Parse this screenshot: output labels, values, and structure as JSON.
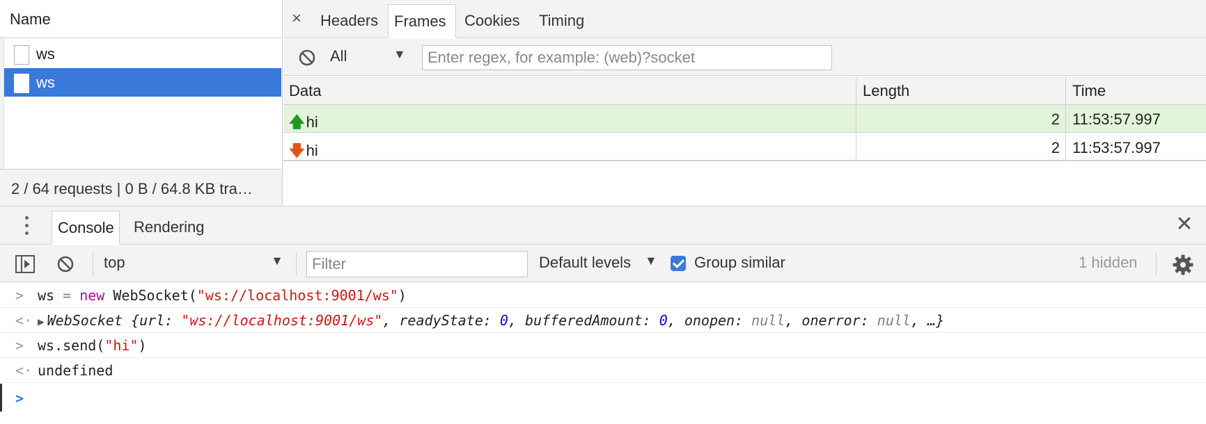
{
  "network": {
    "name_header": "Name",
    "requests": [
      {
        "label": "ws"
      },
      {
        "label": "ws"
      }
    ],
    "footer": "2 / 64 requests | 0 B / 64.8 KB tra…",
    "detail_tabs": {
      "close": "×",
      "headers": "Headers",
      "frames": "Frames",
      "cookies": "Cookies",
      "timing": "Timing"
    },
    "frames_toolbar": {
      "type_filter": "All",
      "search_placeholder": "Enter regex, for example: (web)?socket"
    },
    "frames_table": {
      "columns": [
        "Data",
        "Length",
        "Time"
      ],
      "rows": [
        {
          "direction": "sent",
          "arrow": "🡅",
          "data": "hi",
          "length": "2",
          "time": "11:53:57.997"
        },
        {
          "direction": "received",
          "arrow": "🡇",
          "data": "hi",
          "length": "2",
          "time": "11:53:57.997"
        }
      ]
    }
  },
  "drawer": {
    "tabs": {
      "console": "Console",
      "rendering": "Rendering"
    },
    "close": "✕",
    "toolbar": {
      "context": "top",
      "filter_placeholder": "Filter",
      "levels": "Default levels",
      "group_similar": "Group similar",
      "hidden": "1 hidden"
    },
    "log": {
      "in1_var": "ws",
      "in1_eq": " = ",
      "in1_new": "new",
      "in1_cls": " WebSocket(",
      "in1_str": "\"ws://localhost:9001/ws\"",
      "in1_end": ")",
      "out1_cls": "WebSocket ",
      "out1_open": "{",
      "out1_url_key": "url: ",
      "out1_url_val": "\"ws://localhost:9001/ws\"",
      "out1_rs_key": ", readyState: ",
      "out1_rs_val": "0",
      "out1_ba_key": ", bufferedAmount: ",
      "out1_ba_val": "0",
      "out1_oo_key": ", onopen: ",
      "out1_oo_val": "null",
      "out1_oe_key": ", onerror: ",
      "out1_oe_val": "null",
      "out1_rest": ", …}",
      "in2_pre": "ws.send(",
      "in2_str": "\"hi\"",
      "in2_end": ")",
      "out2": "undefined"
    }
  },
  "colors": {
    "selected_row": "#3879d9",
    "sent_frame_bg": "#e2f4d9",
    "sent_arrow": "#1e9b1e",
    "received_arrow": "#e0531c",
    "accent": "#3a7bd5"
  }
}
